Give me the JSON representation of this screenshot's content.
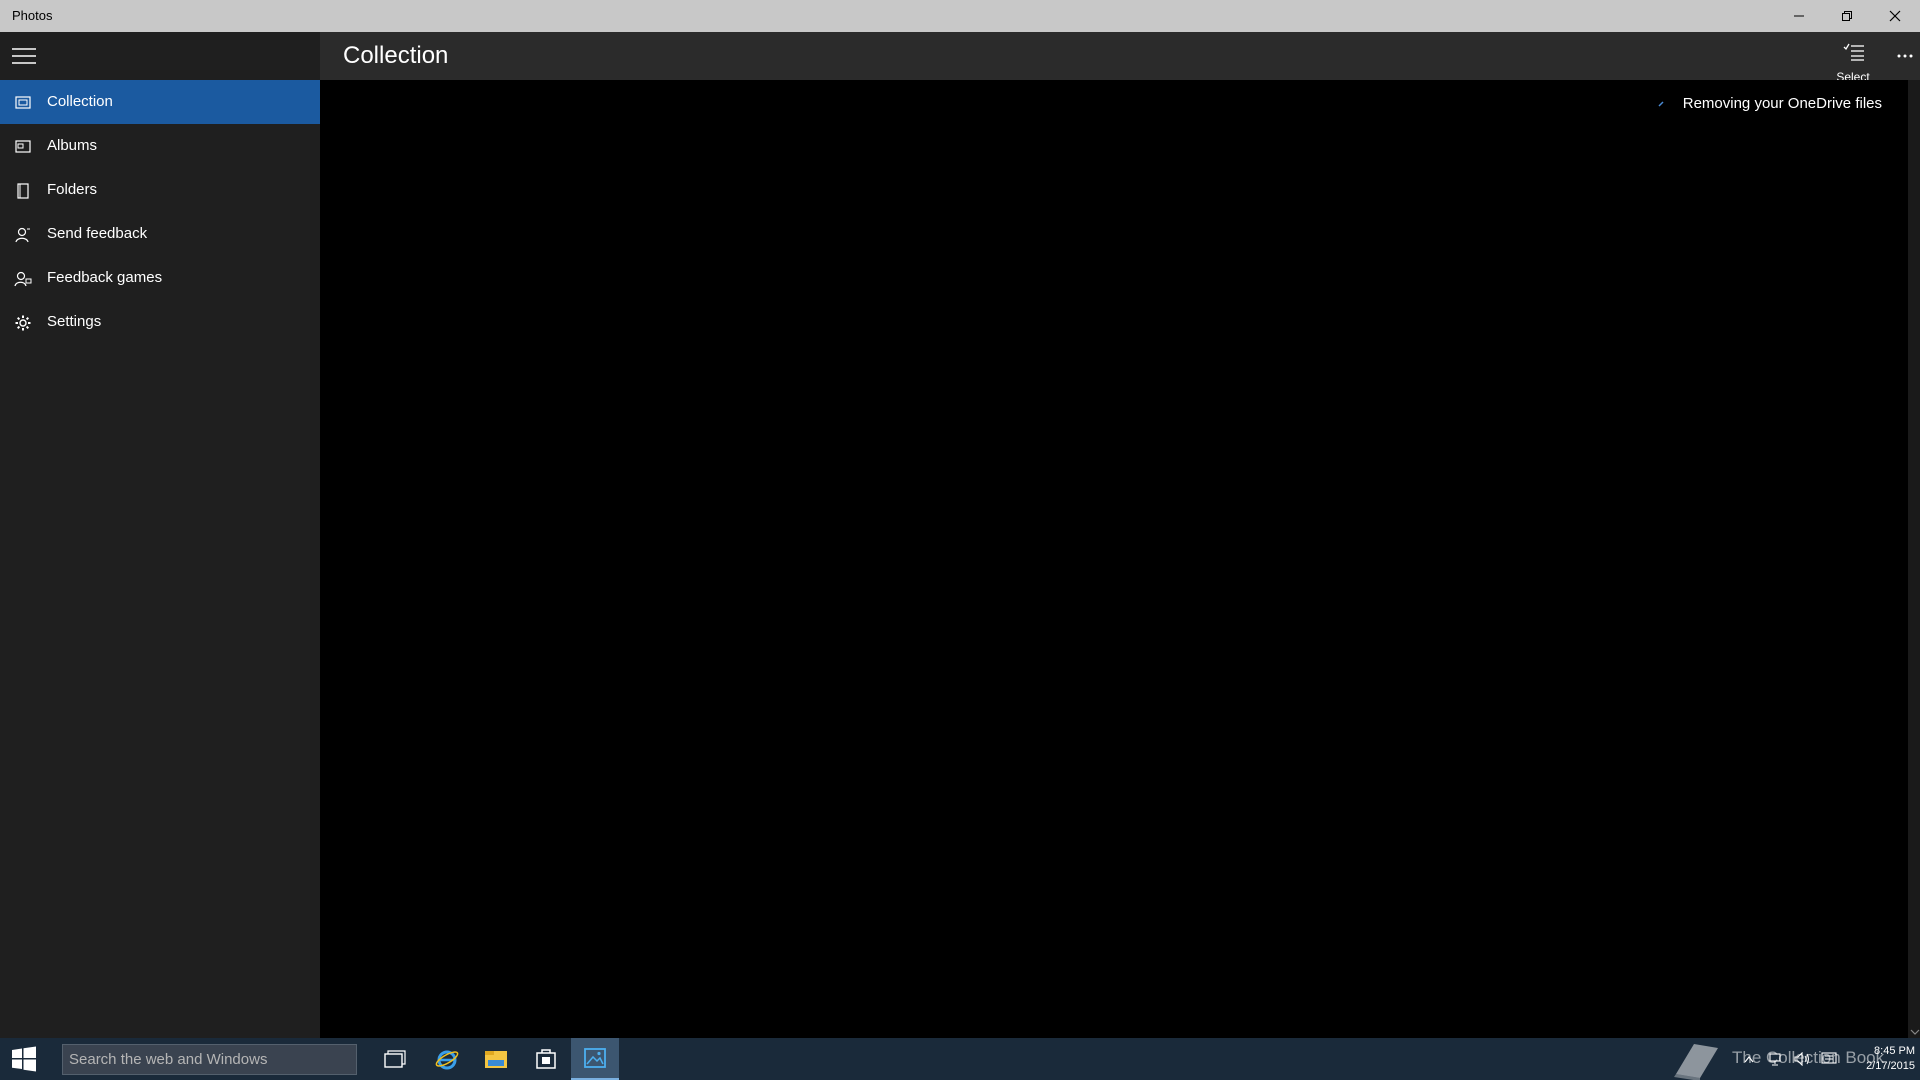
{
  "window": {
    "title": "Photos"
  },
  "sidebar": {
    "items": [
      {
        "label": "Collection",
        "icon": "collection-icon",
        "active": true
      },
      {
        "label": "Albums",
        "icon": "albums-icon",
        "active": false
      },
      {
        "label": "Folders",
        "icon": "folder-icon",
        "active": false
      },
      {
        "label": "Send feedback",
        "icon": "feedback-icon",
        "active": false
      },
      {
        "label": "Feedback games",
        "icon": "feedback-games-icon",
        "active": false
      },
      {
        "label": "Settings",
        "icon": "gear-icon",
        "active": false
      }
    ]
  },
  "header": {
    "title": "Collection",
    "select_label": "Select",
    "more_icon": "more-icon"
  },
  "main": {
    "status": "Removing your OneDrive files"
  },
  "taskbar": {
    "search_placeholder": "Search the web and Windows",
    "watermark": "The Collection Book",
    "time": "8:45 PM",
    "date": "2/17/2015"
  },
  "colors": {
    "accent": "#1b5aa0",
    "sidebar_bg": "#1f1f1f",
    "header_bg": "#2b2b2b",
    "titlebar_bg": "#c8c8c8",
    "taskbar_bg": "#1a2a3a"
  }
}
